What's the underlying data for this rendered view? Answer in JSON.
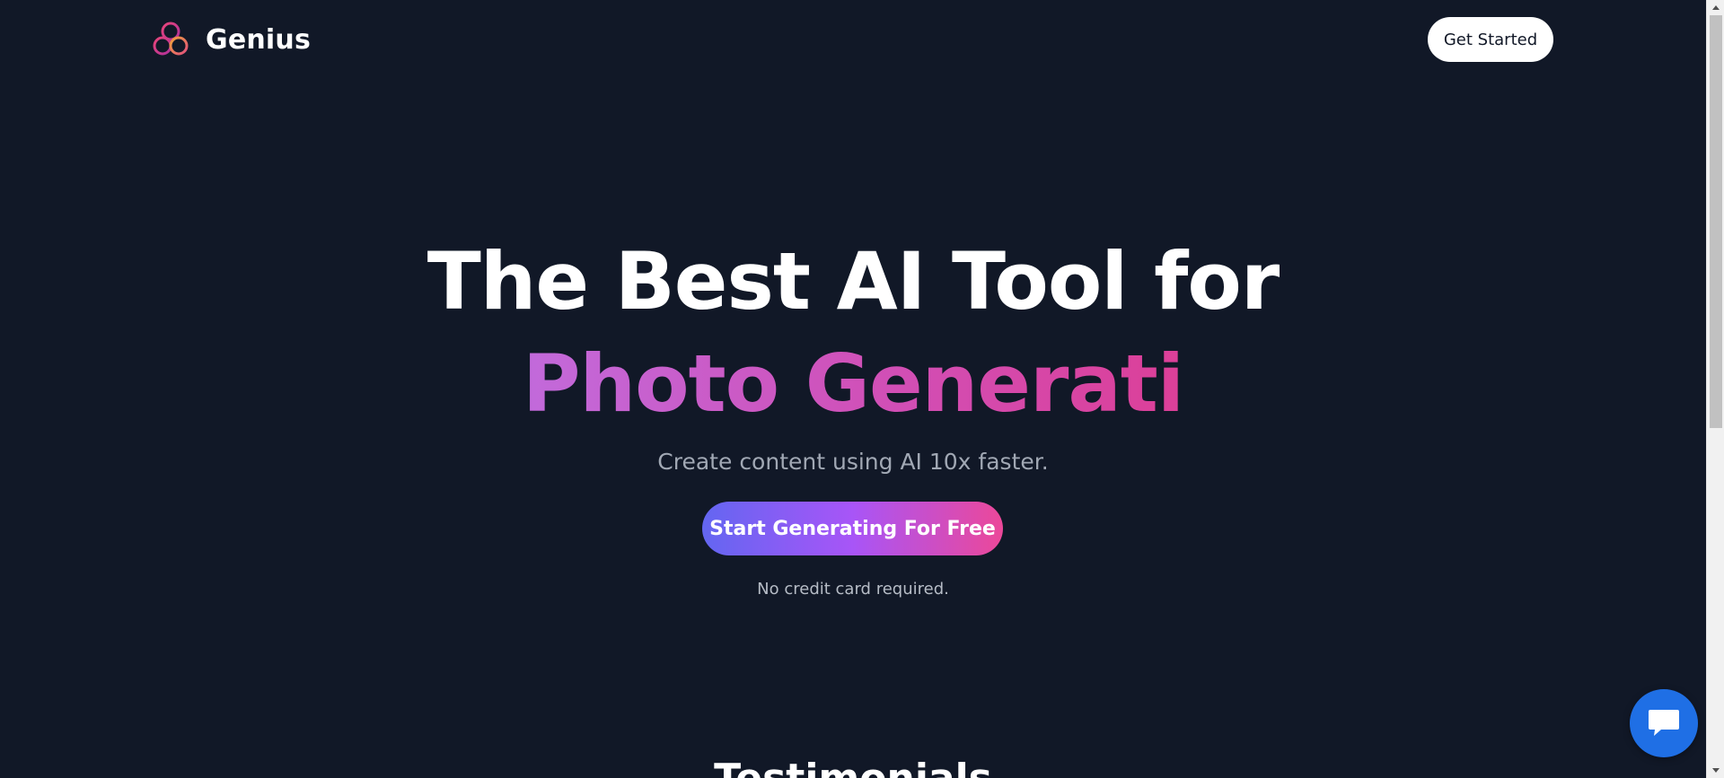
{
  "header": {
    "brand_name": "Genius",
    "logo_icon": "triple-ring-logo-icon",
    "cta_label": "Get Started"
  },
  "hero": {
    "headline": "The Best AI Tool for",
    "typed_text": "Photo Generati",
    "subheadline": "Create content using AI 10x faster.",
    "cta_label": "Start Generating For Free",
    "note": "No credit card required."
  },
  "sections": {
    "testimonials_title": "Testimonials"
  },
  "chat": {
    "icon": "chat-bubble-icon"
  },
  "colors": {
    "background": "#111827",
    "accent_gradient_start": "#6366f1",
    "accent_gradient_end": "#ec4899",
    "chat_button": "#1f6fe5"
  }
}
